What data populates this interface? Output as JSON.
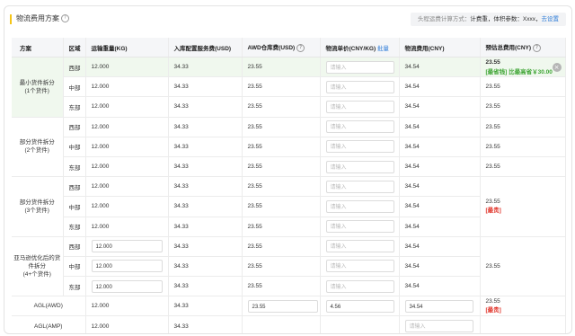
{
  "header": {
    "title": "物流费用方案",
    "notice_prefix": "头程运费计算方式：",
    "notice_value": "计费重，体积参数：Xxxx，",
    "notice_link": "去设置"
  },
  "table": {
    "columns": {
      "plan": "方案",
      "region": "区域",
      "qty": "运输重量(KG)",
      "inbound": "入库配置服务费(USD)",
      "awd": "AWD仓库费(USD)",
      "unit_price": "物流单价(CNY/KG)",
      "unit_price_link": "批量",
      "logistics": "物流费用(CNY)",
      "total": "预估总费用(CNY)"
    },
    "placeholder": "请输入",
    "groups": {
      "g1": "最小货件拆分\n(1个货件)",
      "g2": "部分货件拆分\n(2个货件)",
      "g3": "部分货件拆分\n(3个货件)",
      "g4": "亚马逊优化后的货件拆分\n(4+个货件)",
      "agl_awd": "AGL(AWD)",
      "agl_amp": "AGL(AMP)"
    },
    "regions": {
      "west": "西部",
      "central": "中部",
      "east": "东部"
    },
    "qty": "12.000",
    "inbound": "34.33",
    "awd": "23.55",
    "logistics": "34.54",
    "total": "23.55",
    "agl_awd": {
      "awd": "23.55",
      "unit_price": "4.56",
      "logistics": "34.54"
    },
    "tags": {
      "cheapest": "[最省钱] 比最高省￥30.00",
      "most_expensive": "[最贵]"
    },
    "close_icon": "×"
  }
}
